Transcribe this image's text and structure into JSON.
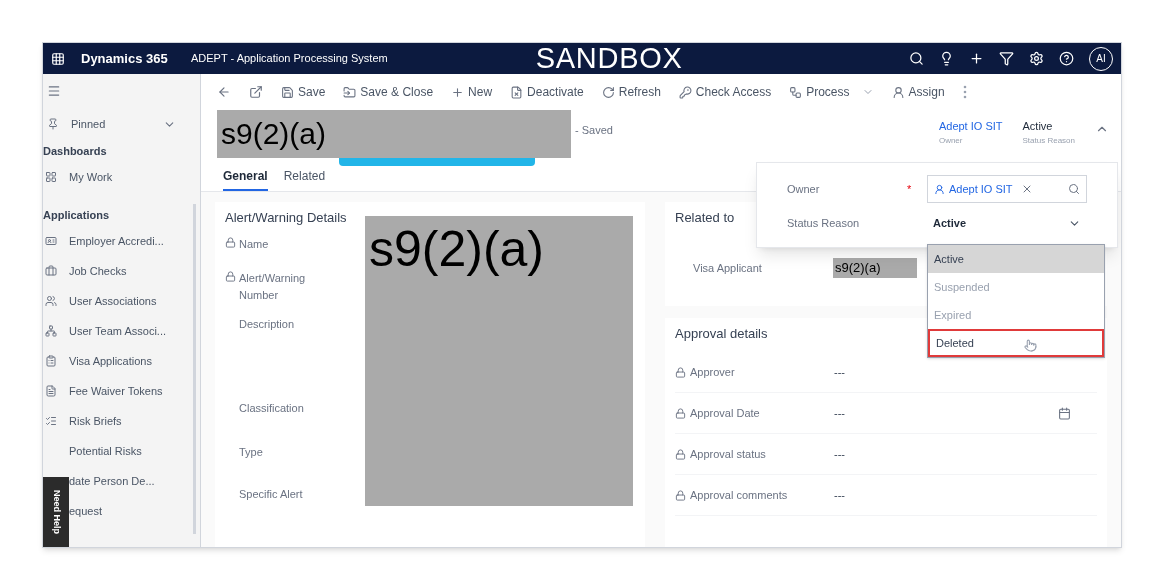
{
  "header": {
    "app_name": "Dynamics 365",
    "app_title": "ADEPT - Application Processing System",
    "environment": "SANDBOX",
    "avatar": "AI"
  },
  "toolbar": [
    {
      "kind": "back"
    },
    {
      "kind": "popout"
    },
    {
      "kind": "button",
      "label": "Save"
    },
    {
      "kind": "button",
      "label": "Save & Close"
    },
    {
      "kind": "button",
      "label": "New"
    },
    {
      "kind": "button",
      "label": "Deactivate"
    },
    {
      "kind": "button",
      "label": "Refresh"
    },
    {
      "kind": "button",
      "label": "Check Access"
    },
    {
      "kind": "menu",
      "label": "Process"
    },
    {
      "kind": "button",
      "label": "Assign"
    },
    {
      "kind": "more"
    }
  ],
  "sidebar": {
    "pinned": "Pinned",
    "groups": [
      {
        "title": "Dashboards",
        "items": [
          {
            "label": "My Work"
          }
        ]
      },
      {
        "title": "Applications",
        "items": [
          {
            "label": "Employer Accredi..."
          },
          {
            "label": "Job Checks"
          },
          {
            "label": "User Associations"
          },
          {
            "label": "User Team Associ..."
          },
          {
            "label": "Visa Applications"
          },
          {
            "label": "Fee Waiver Tokens"
          },
          {
            "label": "Risk Briefs"
          },
          {
            "label": "Potential Risks"
          },
          {
            "label": "date Person De..."
          },
          {
            "label": "equest"
          }
        ]
      }
    ],
    "help": "Need Help"
  },
  "record": {
    "redaction": "s9(2)(a)",
    "saved": "- Saved",
    "owner": {
      "value": "Adept IO SIT",
      "label": "Owner"
    },
    "status": {
      "value": "Active",
      "label": "Status Reason"
    }
  },
  "tabs": [
    {
      "label": "General",
      "selected": true
    },
    {
      "label": "Related",
      "selected": false
    }
  ],
  "details": {
    "title": "Alert/Warning Details",
    "redaction": "s9(2)(a)",
    "fields": [
      {
        "label": "Name",
        "locked": true
      },
      {
        "label": "Alert/Warning Number",
        "locked": true
      },
      {
        "label": "Description",
        "locked": false
      },
      {
        "label": "Classification",
        "locked": false
      },
      {
        "label": "Type",
        "locked": false
      },
      {
        "label": "Specific Alert",
        "locked": false
      }
    ]
  },
  "related": {
    "title": "Related to",
    "field": "Visa Applicant",
    "redaction": "s9(2)(a)"
  },
  "approval": {
    "title": "Approval details",
    "fields": [
      {
        "label": "Approver",
        "value": "---",
        "calendar": false
      },
      {
        "label": "Approval Date",
        "value": "---",
        "calendar": true
      },
      {
        "label": "Approval status",
        "value": "---",
        "calendar": false
      },
      {
        "label": "Approval comments",
        "value": "---",
        "calendar": false
      }
    ]
  },
  "flyout": {
    "owner_label": "Owner",
    "required": "*",
    "owner_value": "Adept IO SIT",
    "status_label": "Status Reason",
    "status_value": "Active",
    "options": [
      {
        "label": "Active",
        "selected": true,
        "disabled": false,
        "highlighted": false
      },
      {
        "label": "Suspended",
        "selected": false,
        "disabled": true,
        "highlighted": false
      },
      {
        "label": "Expired",
        "selected": false,
        "disabled": true,
        "highlighted": false
      },
      {
        "label": "Deleted",
        "selected": false,
        "disabled": false,
        "highlighted": true
      }
    ]
  }
}
